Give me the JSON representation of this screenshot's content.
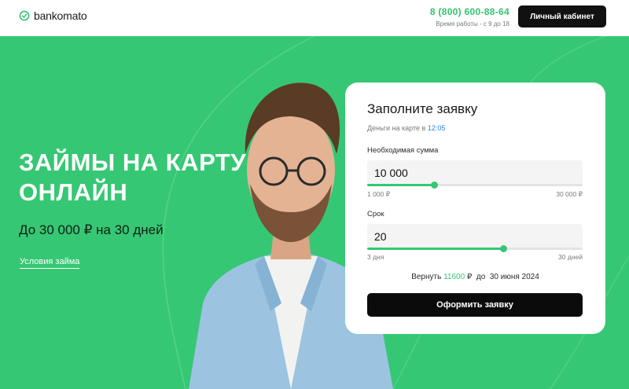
{
  "header": {
    "logo_text": "bankomato",
    "phone": "8 (800) 600-88-64",
    "hours": "Время работы - с 9 до 18",
    "cabinet_button": "Личный кабинет"
  },
  "hero": {
    "title": "ЗАЙМЫ НА КАРТУ ОНЛАЙН",
    "subtitle": "До 30 000 ₽ на 30 дней",
    "terms_link": "Условия займа"
  },
  "form": {
    "title": "Заполните заявку",
    "note_prefix": "Деньги на карте в",
    "note_time": "12:05",
    "amount": {
      "label": "Необходимая сумма",
      "value": "10 000",
      "min_label": "1 000 ₽",
      "max_label": "30 000 ₽",
      "position_fraction": 0.31
    },
    "term": {
      "label": "Срок",
      "value": "20",
      "min_label": "3 дня",
      "max_label": "30 дней",
      "position_fraction": 0.63
    },
    "return_prefix": "Вернуть",
    "return_amount": "11600",
    "return_currency": "₽",
    "return_until": "до",
    "return_date": "30 июня 2024",
    "submit_button": "Оформить заявку"
  },
  "colors": {
    "accent_green": "#36c774",
    "dark": "#111111",
    "link_blue": "#2f80ed"
  }
}
